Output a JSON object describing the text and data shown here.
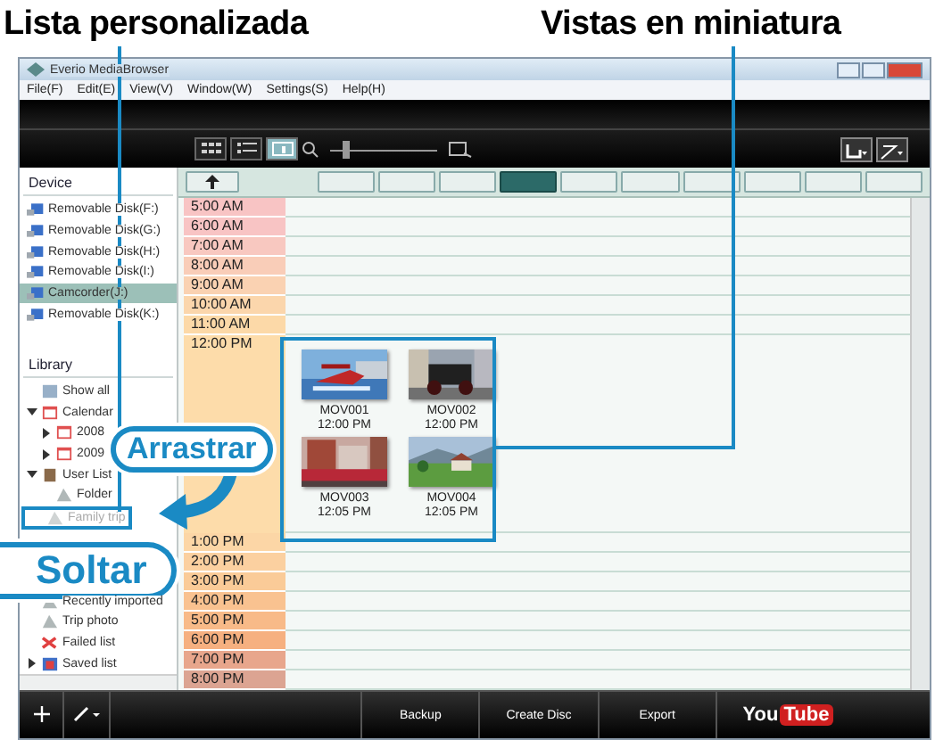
{
  "annotations": {
    "list_label": "Lista personalizada",
    "thumbs_label": "Vistas en miniatura",
    "drag_label": "Arrastrar",
    "drop_label": "Soltar"
  },
  "window": {
    "title": "Everio MediaBrowser"
  },
  "menu": [
    "File(F)",
    "Edit(E)",
    "View(V)",
    "Window(W)",
    "Settings(S)",
    "Help(H)"
  ],
  "view_modes": [
    {
      "selected": false
    },
    {
      "selected": false
    },
    {
      "selected": true
    }
  ],
  "zoom_slider": {
    "level": 0.15
  },
  "nav_buttons": [
    {
      "selected": false
    },
    {
      "selected": false
    },
    {
      "selected": false
    },
    {
      "selected": true
    },
    {
      "selected": false
    },
    {
      "selected": false
    },
    {
      "selected": false
    },
    {
      "selected": false
    },
    {
      "selected": false
    },
    {
      "selected": false
    }
  ],
  "sidebar": {
    "device_title": "Device",
    "devices": [
      {
        "label": "Removable Disk(F:)",
        "selected": false
      },
      {
        "label": "Removable Disk(G:)",
        "selected": false
      },
      {
        "label": "Removable Disk(H:)",
        "selected": false
      },
      {
        "label": "Removable Disk(I:)",
        "selected": false
      },
      {
        "label": "Camcorder(J:)",
        "selected": true
      },
      {
        "label": "Removable Disk(K:)",
        "selected": false
      }
    ],
    "library_title": "Library",
    "library": [
      {
        "label": "Show all",
        "kind": "all"
      },
      {
        "label": "Calendar",
        "kind": "calendar",
        "expanded": true,
        "children": [
          {
            "label": "2008",
            "kind": "calendar",
            "expanded": false
          },
          {
            "label": "2009",
            "kind": "calendar",
            "expanded": false
          }
        ]
      },
      {
        "label": "User List",
        "kind": "list",
        "expanded": true,
        "children": [
          {
            "label": "Folder",
            "kind": "user"
          }
        ]
      },
      {
        "label": "Family trip",
        "kind": "dragged"
      },
      {
        "label": "Recently imported",
        "kind": "user"
      },
      {
        "label": "Trip photo",
        "kind": "user"
      },
      {
        "label": "Failed list",
        "kind": "failed"
      },
      {
        "label": "Saved list",
        "kind": "saved",
        "expanded": false
      }
    ]
  },
  "timeline": {
    "rows": [
      {
        "time": "5:00 AM",
        "color": "#f8c4c4"
      },
      {
        "time": "6:00 AM",
        "color": "#f8c4c4"
      },
      {
        "time": "7:00 AM",
        "color": "#f8c8c0"
      },
      {
        "time": "8:00 AM",
        "color": "#f9cdb8"
      },
      {
        "time": "9:00 AM",
        "color": "#fad2b2"
      },
      {
        "time": "10:00 AM",
        "color": "#fbd6ac"
      },
      {
        "time": "11:00 AM",
        "color": "#fcd9a8"
      },
      {
        "time": "12:00 PM",
        "color": "#fddcaa",
        "thumbnails": [
          {
            "name": "MOV001",
            "time": "12:00 PM"
          },
          {
            "name": "MOV002",
            "time": "12:00 PM"
          },
          {
            "name": "MOV003",
            "time": "12:05 PM"
          },
          {
            "name": "MOV004",
            "time": "12:05 PM"
          }
        ]
      },
      {
        "time": "1:00 PM",
        "color": "#fcd6a6"
      },
      {
        "time": "2:00 PM",
        "color": "#fbd0a0"
      },
      {
        "time": "3:00 PM",
        "color": "#facb98"
      },
      {
        "time": "4:00 PM",
        "color": "#f9c290"
      },
      {
        "time": "5:00 PM",
        "color": "#f8ba88"
      },
      {
        "time": "6:00 PM",
        "color": "#f6b080"
      },
      {
        "time": "7:00 PM",
        "color": "#e8a68c"
      },
      {
        "time": "8:00 PM",
        "color": "#dca492"
      }
    ]
  },
  "bottom_buttons": [
    "Backup",
    "Create Disc",
    "Export"
  ],
  "youtube": {
    "you": "You",
    "tube": "Tube"
  }
}
